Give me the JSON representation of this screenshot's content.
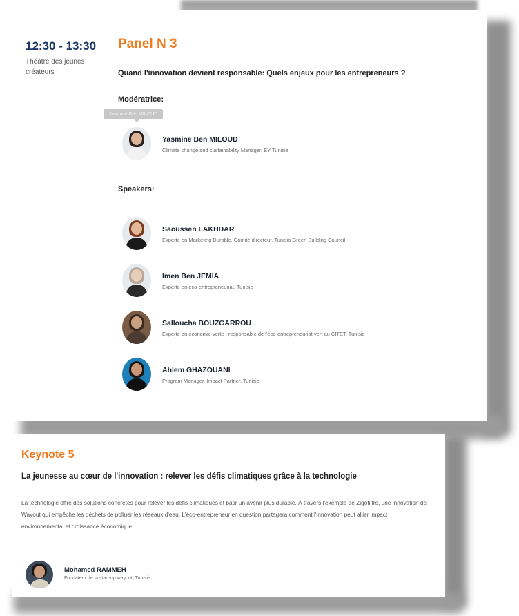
{
  "panel": {
    "time": "12:30 - 13:30",
    "venue": "Théâtre des jeunes créateurs",
    "title": "Panel N 3",
    "subtitle": "Quand l'innovation devient responsable: Quels enjeux pour les entrepreneurs ?",
    "moderator_label": "Modératrice:",
    "tooltip": "Yasmine Ben MILOUD",
    "moderator": {
      "name": "Yasmine Ben MILOUD",
      "role": "Climate change and sustainability Manager, EY Tunisie"
    },
    "speakers_label": "Speakers:",
    "speakers": [
      {
        "name": "Saoussen LAKHDAR",
        "role": "Experte en Marketing Durable, Comité directeur, Tunisia Green Building Council"
      },
      {
        "name": "Imen Ben JEMIA",
        "role": "Experte en éco-entrepreneuriat, Tunisie"
      },
      {
        "name": "Salloucha BOUZGARROU",
        "role": "Experte en économie verte : responsable de l'éco-entrepreneuriat vert au CITET, Tunisie"
      },
      {
        "name": "Ahlem GHAZOUANI",
        "role": "Program Manager, Impact Partner, Tunisie"
      }
    ]
  },
  "keynote": {
    "title": "Keynote 5",
    "subtitle": "La jeunesse au cœur de l'innovation : relever les défis climatiques grâce à la technologie",
    "body": " La technologie offre des solutions concrètes pour relever les défis climatiques et bâtir un avenir plus durable. À travers l'exemple de Zigofiltre, une innovation de Wayout qui empêche les déchets de polluer les réseaux d'eau, L'éco-entrepreneur en question partagera comment l'innovation peut allier impact environnemental et croissance économique.",
    "speaker": {
      "name": "Mohamed RAMMEH",
      "role": "Fondateur de la start-up wayout, Tunisie"
    }
  },
  "colors": {
    "accent": "#f07a1e",
    "time": "#1b3566"
  }
}
